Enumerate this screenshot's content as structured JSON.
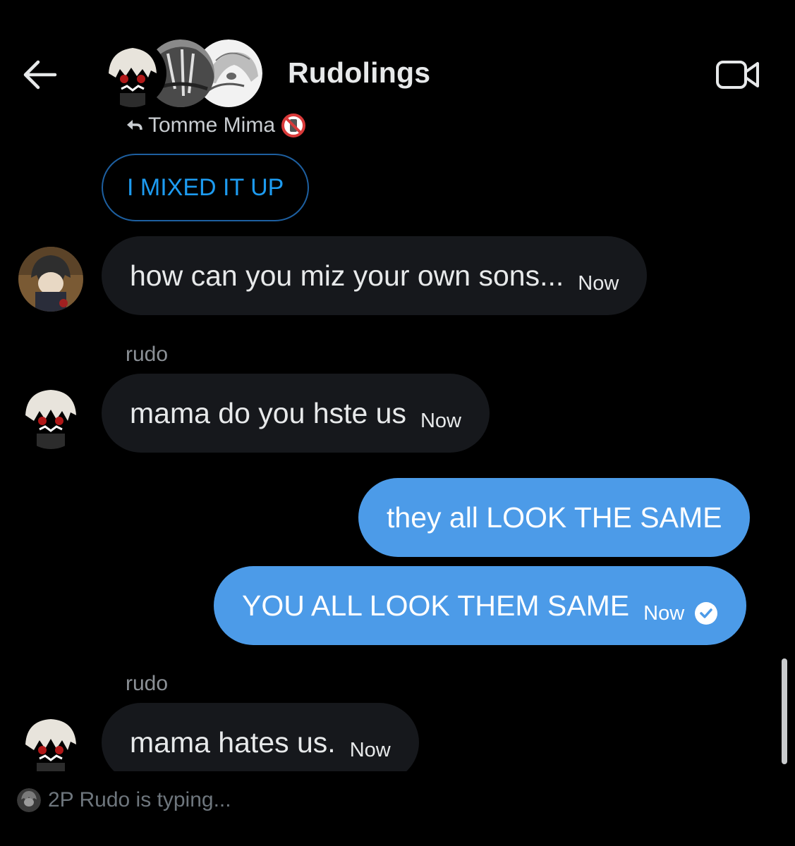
{
  "header": {
    "back_icon": "arrow-left-icon",
    "title": "Rudolings",
    "video_icon": "video-camera-icon"
  },
  "reply": {
    "icon": "reply-arrow-icon",
    "name": "Tomme Mima",
    "emoji_icon": "no-symbol-emoji-icon",
    "quoted_text": "I MIXED IT UP"
  },
  "messages": [
    {
      "direction": "in",
      "sender": "",
      "text": "how can you miz your own sons...",
      "time": "Now"
    },
    {
      "direction": "in",
      "sender": "rudo",
      "text": "mama do you hste us",
      "time": "Now"
    },
    {
      "direction": "out",
      "sender": "",
      "text": "they all LOOK THE SAME",
      "time": ""
    },
    {
      "direction": "out",
      "sender": "",
      "text": "YOU ALL LOOK THEM SAME",
      "time": "Now"
    },
    {
      "direction": "in",
      "sender": "rudo",
      "text": "mama hates us.",
      "time": "Now"
    }
  ],
  "typing": {
    "text": "2P Rudo is typing..."
  },
  "colors": {
    "background": "#000000",
    "incoming_bubble": "#16181c",
    "outgoing_bubble": "#4c9be8",
    "accent": "#1d9bf0"
  }
}
